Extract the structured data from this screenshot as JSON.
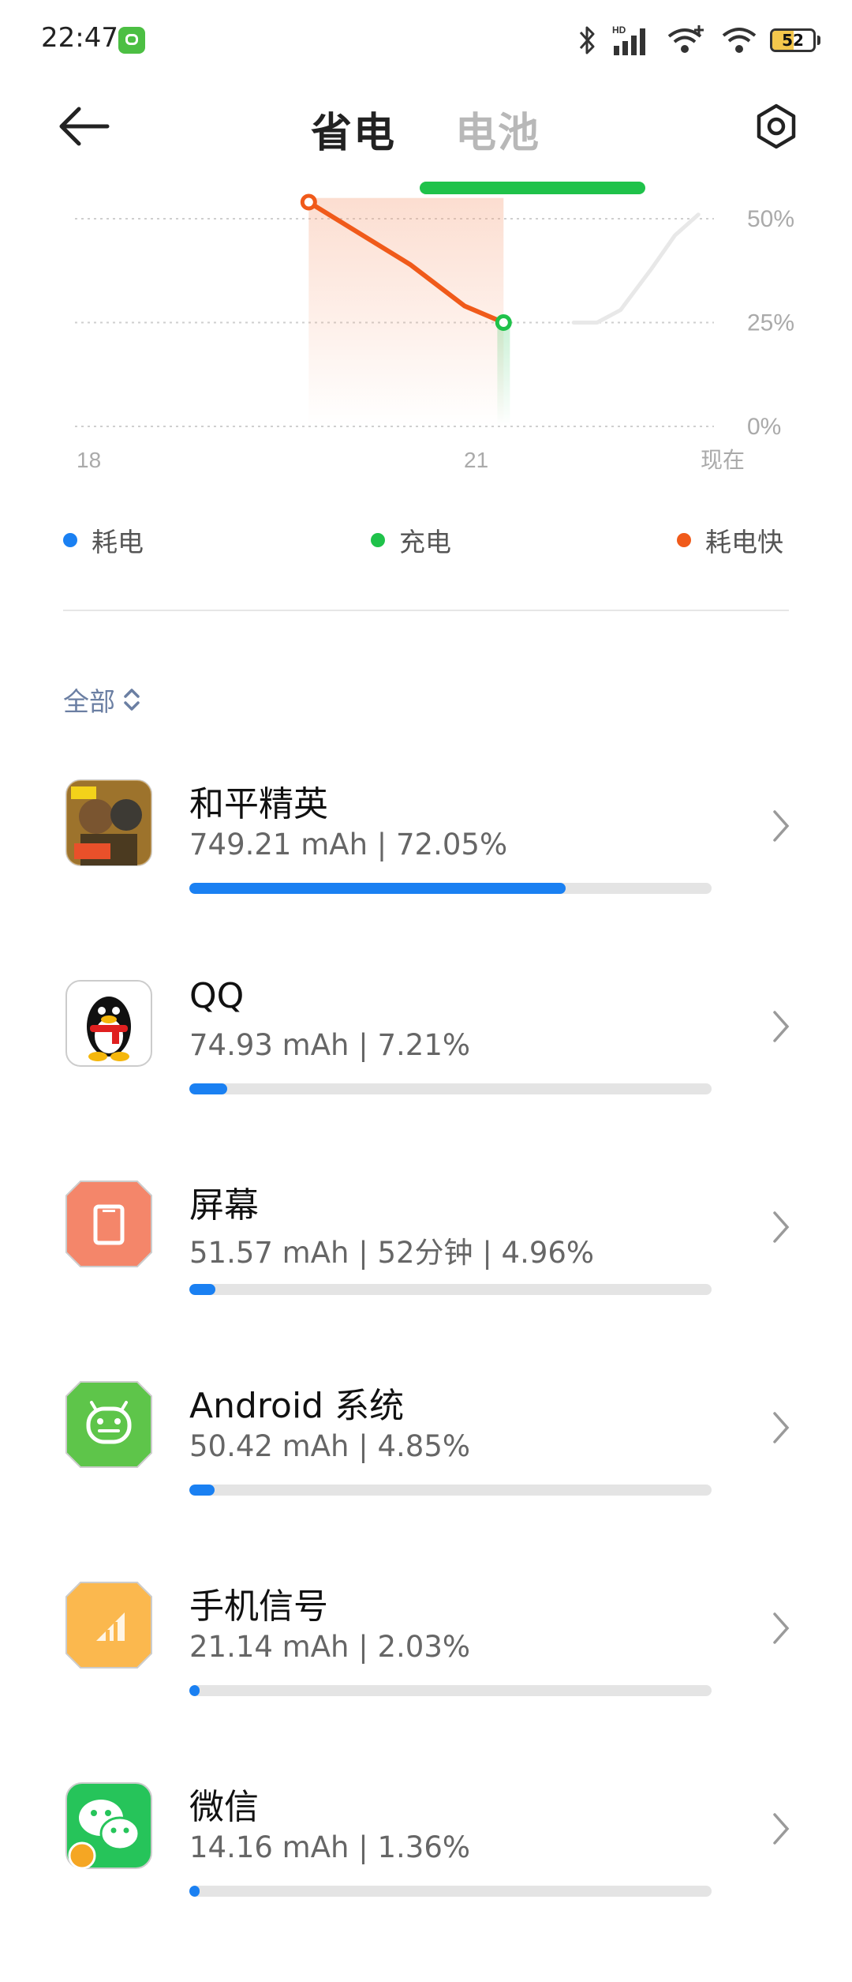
{
  "status_bar": {
    "time": "22:47",
    "hd_label": "HD",
    "battery_level": "52",
    "icons": [
      "app-notification-icon",
      "bluetooth-icon",
      "signal-icon",
      "wifi-plus-icon",
      "wifi-icon",
      "battery-icon"
    ]
  },
  "header": {
    "tabs": [
      {
        "label": "省电",
        "active": true
      },
      {
        "label": "电池",
        "active": false
      }
    ]
  },
  "chart_data": {
    "type": "line",
    "ytick_labels": [
      "50%",
      "25%",
      "0%"
    ],
    "xtick_labels": [
      "18",
      "21",
      "现在"
    ],
    "ylim": [
      0,
      60
    ],
    "series": [
      {
        "kind": "past",
        "color": "#e8e8e8",
        "points": [
          [
            24.4,
            25
          ],
          [
            24.7,
            25
          ],
          [
            25.0,
            28
          ],
          [
            25.4,
            38
          ],
          [
            25.7,
            46
          ],
          [
            26.0,
            51
          ]
        ]
      },
      {
        "kind": "fast-drain",
        "color": "#f05a1a",
        "points": [
          [
            21.0,
            54
          ],
          [
            22.3,
            39
          ],
          [
            23.0,
            29
          ],
          [
            23.5,
            25
          ]
        ]
      }
    ],
    "charging_region": {
      "x_start": 23.1,
      "x_end": 23.8,
      "color": "#2ec45a"
    },
    "fast_drain_region": {
      "x_start": 21.0,
      "x_end": 23.5
    },
    "markers": [
      {
        "x": 21.0,
        "y": 54,
        "color": "#f05a1a"
      },
      {
        "x": 23.5,
        "y": 25,
        "color": "#1fc24a"
      }
    ],
    "grid": true
  },
  "legend": [
    {
      "label": "耗电",
      "color": "#1a80f2"
    },
    {
      "label": "充电",
      "color": "#1fc24a"
    },
    {
      "label": "耗电快",
      "color": "#f05a1a"
    }
  ],
  "filter": {
    "label": "全部"
  },
  "apps": [
    {
      "name": "和平精英",
      "detail": "749.21 mAh | 72.05%",
      "percent": 72.05,
      "icon": "game-icon"
    },
    {
      "name": "QQ",
      "detail": "74.93 mAh | 7.21%",
      "percent": 7.21,
      "icon": "qq-penguin-icon"
    },
    {
      "name": "屏幕",
      "detail": "51.57 mAh | 52分钟 | 4.96%",
      "percent": 4.96,
      "icon": "screen-icon"
    },
    {
      "name": "Android 系统",
      "detail": "50.42 mAh | 4.85%",
      "percent": 4.85,
      "icon": "android-icon"
    },
    {
      "name": "手机信号",
      "detail": "21.14 mAh | 2.03%",
      "percent": 2.03,
      "icon": "cell-signal-icon"
    },
    {
      "name": "微信",
      "detail": "14.16 mAh | 1.36%",
      "percent": 1.36,
      "icon": "wechat-icon"
    }
  ]
}
